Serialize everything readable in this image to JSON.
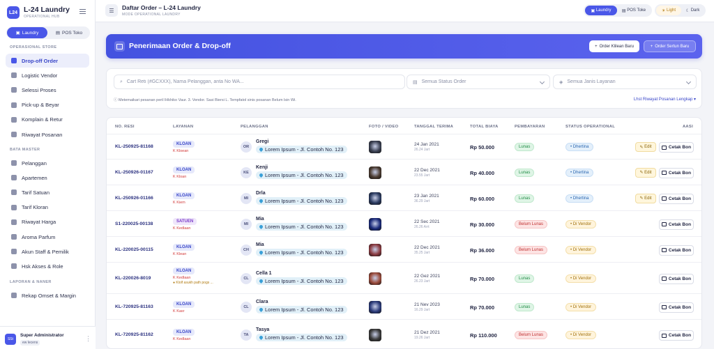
{
  "sidebar": {
    "brand": {
      "logo": "L24",
      "name": "L-24 Laundry",
      "subtitle": "OPERATIONAL HUB"
    },
    "switch": {
      "laundry": "Laundry",
      "pos": "POS Toko"
    },
    "sections": [
      {
        "title": "OPERASIONAL STORE",
        "items": [
          {
            "label": "Drop-off Order",
            "active": true,
            "icon": "basket-icon"
          },
          {
            "label": "Logistic Vendor",
            "icon": "truck-icon"
          },
          {
            "label": "Selessi Proses",
            "icon": "shield-icon"
          },
          {
            "label": "Pick-up & Beyar",
            "icon": "pickup-icon"
          },
          {
            "label": "Komplain & Retur",
            "icon": "cart-icon"
          },
          {
            "label": "Riwayat Posanan",
            "icon": "history-icon"
          }
        ]
      },
      {
        "title": "BATA MASTER",
        "items": [
          {
            "label": "Pelanggan",
            "icon": "users-icon"
          },
          {
            "label": "Apartemen",
            "icon": "building-icon"
          },
          {
            "label": "Tarif Satuan",
            "icon": "tag-icon"
          },
          {
            "label": "Tarif Kloran",
            "icon": "tag-icon"
          },
          {
            "label": "Riwayat Harga",
            "icon": "chart-icon"
          },
          {
            "label": "Aroma Parfum",
            "icon": "drop-icon"
          },
          {
            "label": "Akun Staff & Pemilik",
            "icon": "user-icon"
          },
          {
            "label": "Hsk Akses & Role",
            "icon": "lock-icon"
          }
        ]
      },
      {
        "title": "LAPORAN & NANER",
        "items": [
          {
            "label": "Rekap Omset & Margin",
            "icon": "report-icon"
          }
        ]
      }
    ],
    "user": {
      "avatar": "SSt",
      "name": "Super Administrator",
      "role": "ew lecens"
    }
  },
  "topbar": {
    "title": "Daftar Order – L-24 Laundry",
    "subtitle": "MODE OPERATIONAL LAUNDRY",
    "switch": {
      "laundry": "Laundry",
      "pos": "POS Toke"
    },
    "theme": {
      "light": "Light",
      "dark": "Dark"
    }
  },
  "hero": {
    "title": "Penerimaan Order & Drop-off",
    "btn_new_customer": "Order Klilean Baru",
    "btn_unit": "Order Sertun Baru"
  },
  "filters": {
    "search_placeholder": "Cart Reti (#GCXXX), Nama Pelanggan, anta No WA...",
    "status": "Semua Status Order",
    "service": "Semua Janis Layanan",
    "note": "Metemaikari pesanan peril lHkhiko Vaur. 3. Vendor. Sasi Biersi L. Tempfatol sinis posanan Belum lsin Wi.",
    "history_link": "Lhst Riwayat Posanan Lengkap"
  },
  "table": {
    "headers": [
      "NO. RESI",
      "LAYANAN",
      "PELANGGAN",
      "FOTO / VIDEO",
      "TANGGAL TERIMA",
      "TOTAL BIAYA",
      "PEMBAYARAN",
      "STATUS OPERATIONAL",
      "AASI"
    ],
    "edit_label": "Edit",
    "print_label": "Cetak Bon",
    "rows": [
      {
        "resi": "KL-250925-81168",
        "service": "KLOAN",
        "svc_type": "kl",
        "sub": "K Kloean",
        "warn": "",
        "initials": "OR",
        "name": "Gregi",
        "addr": "Lorem Ipsum - Jl. Contoh No. 123",
        "photo": "#3a4052",
        "date": "24 Jan 2021",
        "time": "26.24 Jart",
        "price": "Rp 50.000",
        "pay": "Lunas",
        "pay_type": "lunas",
        "status": "Dhertina",
        "st_type": "diterima",
        "edit": true
      },
      {
        "resi": "KL-250926-01167",
        "service": "KLOAN",
        "svc_type": "kl",
        "sub": "K Kloan",
        "warn": "",
        "initials": "KE",
        "name": "Kenji",
        "addr": "Lorem Ipsum - Jl. Contoh No. 123",
        "photo": "#4a3a30",
        "date": "22 Dec 2021",
        "time": "23.55 Jart",
        "price": "Rp 40.000",
        "pay": "Lunas",
        "pay_type": "lunas",
        "status": "Dhertina",
        "st_type": "diterima",
        "edit": true
      },
      {
        "resi": "KL-250926-01166",
        "service": "KLOAN",
        "svc_type": "kl",
        "sub": "K Kiem",
        "warn": "",
        "initials": "MI",
        "name": "Drla",
        "addr": "Lorem Ipsum - Jl. Contoh No. 123",
        "photo": "#2a3a60",
        "date": "23 Jan 2021",
        "time": "36.29 Jart",
        "price": "Rp 60.000",
        "pay": "Lunas",
        "pay_type": "lunas",
        "status": "Dhertina",
        "st_type": "diterima",
        "edit": true
      },
      {
        "resi": "S1-220025-00138",
        "service": "SATUEN",
        "svc_type": "st",
        "sub": "K Kedlaan",
        "warn": "",
        "initials": "MI",
        "name": "Mia",
        "addr": "Lorem Ipsum - Jl. Contoh No. 123",
        "photo": "#1a2a7a",
        "date": "22 Sec 2021",
        "time": "26.26 Arrt",
        "price": "Rp 30.000",
        "pay": "Belum Lunas",
        "pay_type": "belum",
        "status": "Di Vendor",
        "st_type": "vendor",
        "edit": false
      },
      {
        "resi": "KL-220025-00115",
        "service": "KLOAN",
        "svc_type": "kl",
        "sub": "K Klean",
        "warn": "",
        "initials": "CH",
        "name": "Mia",
        "addr": "Lorem Ipsum - Jl. Contoh No. 123",
        "photo": "#8a3a40",
        "date": "22 Dec 2021",
        "time": "35.25 Jart",
        "price": "Rp 36.000",
        "pay": "Belum Lunas",
        "pay_type": "belum",
        "status": "Di Vendor",
        "st_type": "vendor",
        "edit": false
      },
      {
        "resi": "KL-220026-8019",
        "service": "KLOAN",
        "svc_type": "kl",
        "sub": "K Kedlaan",
        "warn": "Klolf asukh path pogs ...",
        "initials": "CL",
        "name": "Cella 1",
        "addr": "Lorem Ipsum - Jl. Contoh No. 123",
        "photo": "#9a4a3a",
        "date": "22 Gez 2021",
        "time": "26.23 Jart",
        "price": "Rp 70.000",
        "pay": "Lunas",
        "pay_type": "lunas",
        "status": "Di Vendor",
        "st_type": "vendor",
        "edit": false
      },
      {
        "resi": "KL-720925-81163",
        "service": "KLOAN",
        "svc_type": "kl",
        "sub": "K Kasr",
        "warn": "",
        "initials": "CL",
        "name": "Clara",
        "addr": "Lorem Ipsum - Jl. Contoh No. 123",
        "photo": "#2a3a7a",
        "date": "21 Nev 2023",
        "time": "16.29 Jart",
        "price": "Rp 70.000",
        "pay": "Lunas",
        "pay_type": "lunas",
        "status": "Di Vendor",
        "st_type": "vendor",
        "edit": false
      },
      {
        "resi": "KL-720925-81162",
        "service": "KLOAN",
        "svc_type": "kl",
        "sub": "K Kedlaan",
        "warn": "",
        "initials": "TA",
        "name": "Tasya",
        "addr": "Lorem Ipsum - Jl. Contoh No. 123",
        "photo": "#3a3a3a",
        "date": "21 Dez 2021",
        "time": "19.26 Jart",
        "price": "Rp 110.000",
        "pay": "Belum Lunas",
        "pay_type": "belum",
        "status": "Di Vendor",
        "st_type": "vendor",
        "edit": false
      }
    ]
  }
}
